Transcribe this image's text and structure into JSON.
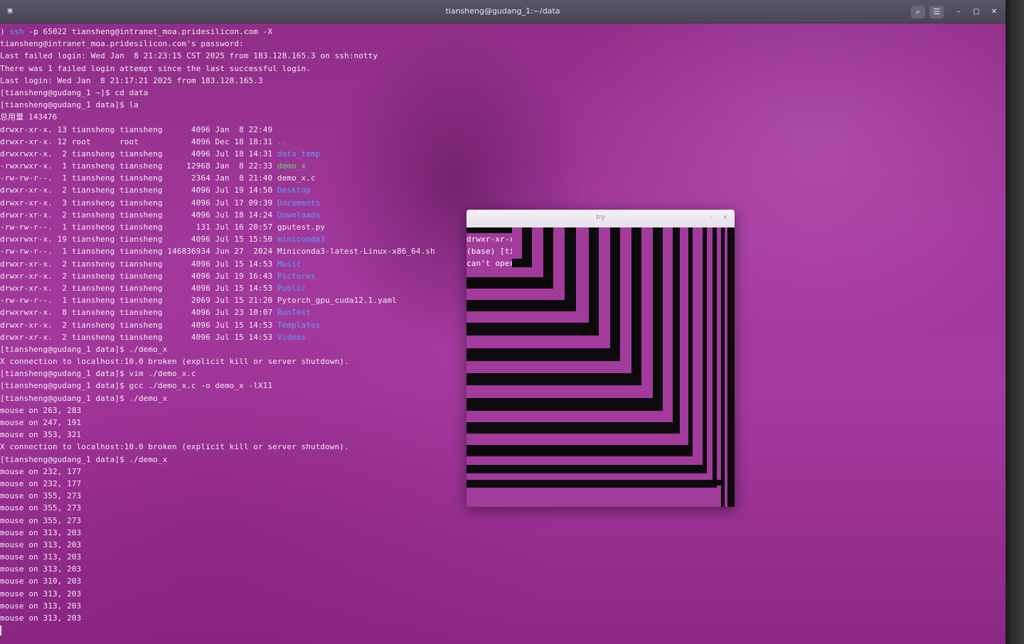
{
  "window": {
    "title": "tiansheng@gudang_1:~/data",
    "app_icon": "terminal-icon",
    "search_icon": "search-icon",
    "menu_icon": "hamburger-menu-icon",
    "minimize_icon": "minimize-icon",
    "maximize_icon": "maximize-icon",
    "close_icon": "close-icon"
  },
  "terminal": {
    "lines": [
      {
        "segments": [
          {
            "t": ") ",
            "c": "normal"
          },
          {
            "t": "ssh",
            "c": "blue"
          },
          {
            "t": " -p 65022 tiansheng@intranet_moa.pridesilicon.com -X",
            "c": "normal"
          }
        ]
      },
      {
        "segments": [
          {
            "t": "tiansheng@intranet_moa.pridesilicon.com's password:",
            "c": "normal"
          }
        ]
      },
      {
        "segments": [
          {
            "t": "Last failed login: Wed Jan  8 21:23:15 CST 2025 from 183.128.165.3 on ssh:notty",
            "c": "normal"
          }
        ]
      },
      {
        "segments": [
          {
            "t": "There was 1 failed login attempt since the last successful login.",
            "c": "normal"
          }
        ]
      },
      {
        "segments": [
          {
            "t": "Last login: Wed Jan  8 21:17:21 2025 from 183.128.165.3",
            "c": "normal"
          }
        ]
      },
      {
        "segments": [
          {
            "t": "[tiansheng@gudang_1 ~]$ cd data",
            "c": "normal"
          }
        ]
      },
      {
        "segments": [
          {
            "t": "[tiansheng@gudang_1 data]$ la",
            "c": "normal"
          }
        ]
      },
      {
        "segments": [
          {
            "t": "总用量 143476",
            "c": "normal"
          }
        ]
      },
      {
        "segments": [
          {
            "t": "drwxr-xr-x. 13 tiansheng tiansheng      4096 Jan  8 22:49 ",
            "c": "normal"
          },
          {
            "t": ".",
            "c": "blue"
          }
        ]
      },
      {
        "segments": [
          {
            "t": "drwxr-xr-x. 12 root      root           4096 Dec 18 18:31 ",
            "c": "normal"
          },
          {
            "t": "..",
            "c": "blue"
          }
        ]
      },
      {
        "segments": [
          {
            "t": "drwxrwxr-x.  2 tiansheng tiansheng      4096 Jul 18 14:31 ",
            "c": "normal"
          },
          {
            "t": "data_temp",
            "c": "blue"
          }
        ]
      },
      {
        "segments": [
          {
            "t": "-rwxrwxr-x.  1 tiansheng tiansheng     12968 Jan  8 22:33 ",
            "c": "normal"
          },
          {
            "t": "demo_x",
            "c": "green"
          }
        ]
      },
      {
        "segments": [
          {
            "t": "-rw-rw-r--.  1 tiansheng tiansheng      2364 Jan  8 21:40 demo_x.c",
            "c": "normal"
          }
        ]
      },
      {
        "segments": [
          {
            "t": "drwxr-xr-x.  2 tiansheng tiansheng      4096 Jul 19 14:50 ",
            "c": "normal"
          },
          {
            "t": "Desktop",
            "c": "blue"
          }
        ]
      },
      {
        "segments": [
          {
            "t": "drwxr-xr-x.  3 tiansheng tiansheng      4096 Jul 17 09:39 ",
            "c": "normal"
          },
          {
            "t": "Documents",
            "c": "blue"
          }
        ]
      },
      {
        "segments": [
          {
            "t": "drwxr-xr-x.  2 tiansheng tiansheng      4096 Jul 18 14:24 ",
            "c": "normal"
          },
          {
            "t": "Downloads",
            "c": "blue"
          }
        ]
      },
      {
        "segments": [
          {
            "t": "-rw-rw-r--.  1 tiansheng tiansheng       131 Jul 16 20:57 gputest.py",
            "c": "normal"
          }
        ]
      },
      {
        "segments": [
          {
            "t": "drwxrwxr-x. 19 tiansheng tiansheng      4096 Jul 15 15:50 ",
            "c": "normal"
          },
          {
            "t": "miniconda3",
            "c": "blue"
          }
        ]
      },
      {
        "segments": [
          {
            "t": "-rw-rw-r--.  1 tiansheng tiansheng 146836934 Jun 27  2024 Miniconda3-latest-Linux-x86_64.sh",
            "c": "normal"
          }
        ]
      },
      {
        "segments": [
          {
            "t": "drwxr-xr-x.  2 tiansheng tiansheng      4096 Jul 15 14:53 ",
            "c": "normal"
          },
          {
            "t": "Music",
            "c": "blue"
          }
        ]
      },
      {
        "segments": [
          {
            "t": "drwxr-xr-x.  2 tiansheng tiansheng      4096 Jul 19 16:43 ",
            "c": "normal"
          },
          {
            "t": "Pictures",
            "c": "blue"
          }
        ]
      },
      {
        "segments": [
          {
            "t": "drwxr-xr-x.  2 tiansheng tiansheng      4096 Jul 15 14:53 ",
            "c": "normal"
          },
          {
            "t": "Public",
            "c": "blue"
          }
        ]
      },
      {
        "segments": [
          {
            "t": "-rw-rw-r--.  1 tiansheng tiansheng      2069 Jul 15 21:20 Pytorch_gpu_cuda12.1.yaml",
            "c": "normal"
          }
        ]
      },
      {
        "segments": [
          {
            "t": "drwxrwxr-x.  8 tiansheng tiansheng      4096 Jul 23 10:07 ",
            "c": "normal"
          },
          {
            "t": "RunTest",
            "c": "blue"
          }
        ]
      },
      {
        "segments": [
          {
            "t": "drwxr-xr-x.  2 tiansheng tiansheng      4096 Jul 15 14:53 ",
            "c": "normal"
          },
          {
            "t": "Templates",
            "c": "blue"
          }
        ]
      },
      {
        "segments": [
          {
            "t": "drwxr-xr-x.  2 tiansheng tiansheng      4096 Jul 15 14:53 ",
            "c": "normal"
          },
          {
            "t": "Videos",
            "c": "blue"
          }
        ]
      },
      {
        "segments": [
          {
            "t": "[tiansheng@gudang_1 data]$ ./demo_x",
            "c": "normal"
          }
        ]
      },
      {
        "segments": [
          {
            "t": "X connection to localhost:10.0 broken (explicit kill or server shutdown).",
            "c": "normal"
          }
        ]
      },
      {
        "segments": [
          {
            "t": "[tiansheng@gudang_1 data]$ vim ./demo_x.c",
            "c": "normal"
          }
        ]
      },
      {
        "segments": [
          {
            "t": "[tiansheng@gudang_1 data]$ gcc ./demo_x.c -o demo_x -lX11",
            "c": "normal"
          }
        ]
      },
      {
        "segments": [
          {
            "t": "[tiansheng@gudang_1 data]$ ./demo_x",
            "c": "normal"
          }
        ]
      },
      {
        "segments": [
          {
            "t": "mouse on 263, 283",
            "c": "normal"
          }
        ]
      },
      {
        "segments": [
          {
            "t": "mouse on 247, 191",
            "c": "normal"
          }
        ]
      },
      {
        "segments": [
          {
            "t": "mouse on 353, 321",
            "c": "normal"
          }
        ]
      },
      {
        "segments": [
          {
            "t": "X connection to localhost:10.0 broken (explicit kill or server shutdown).",
            "c": "normal"
          }
        ]
      },
      {
        "segments": [
          {
            "t": "[tiansheng@gudang_1 data]$ ./demo_x",
            "c": "normal"
          }
        ]
      },
      {
        "segments": [
          {
            "t": "mouse on 232, 177",
            "c": "normal"
          }
        ]
      },
      {
        "segments": [
          {
            "t": "mouse on 232, 177",
            "c": "normal"
          }
        ]
      },
      {
        "segments": [
          {
            "t": "mouse on 355, 273",
            "c": "normal"
          }
        ]
      },
      {
        "segments": [
          {
            "t": "mouse on 355, 273",
            "c": "normal"
          }
        ]
      },
      {
        "segments": [
          {
            "t": "mouse on 355, 273",
            "c": "normal"
          }
        ]
      },
      {
        "segments": [
          {
            "t": "mouse on 313, 203",
            "c": "normal"
          }
        ]
      },
      {
        "segments": [
          {
            "t": "mouse on 313, 203",
            "c": "normal"
          }
        ]
      },
      {
        "segments": [
          {
            "t": "mouse on 313, 203",
            "c": "normal"
          }
        ]
      },
      {
        "segments": [
          {
            "t": "mouse on 313, 203",
            "c": "normal"
          }
        ]
      },
      {
        "segments": [
          {
            "t": "mouse on 310, 203",
            "c": "normal"
          }
        ]
      },
      {
        "segments": [
          {
            "t": "mouse on 313, 203",
            "c": "normal"
          }
        ]
      },
      {
        "segments": [
          {
            "t": "mouse on 313, 203",
            "c": "normal"
          }
        ]
      },
      {
        "segments": [
          {
            "t": "mouse on 313, 203",
            "c": "normal"
          }
        ]
      }
    ]
  },
  "xwindow": {
    "title": "try",
    "bleed_lines": [
      "drwxr-xr-x",
      "(base) [ti",
      "can't oper"
    ],
    "colors": {
      "pink": "#a23b9c",
      "black": "#0d0a0d"
    }
  },
  "colors": {
    "normal": "#f3eaf1",
    "blue": "#57a4ff",
    "green": "#5ee06b"
  }
}
